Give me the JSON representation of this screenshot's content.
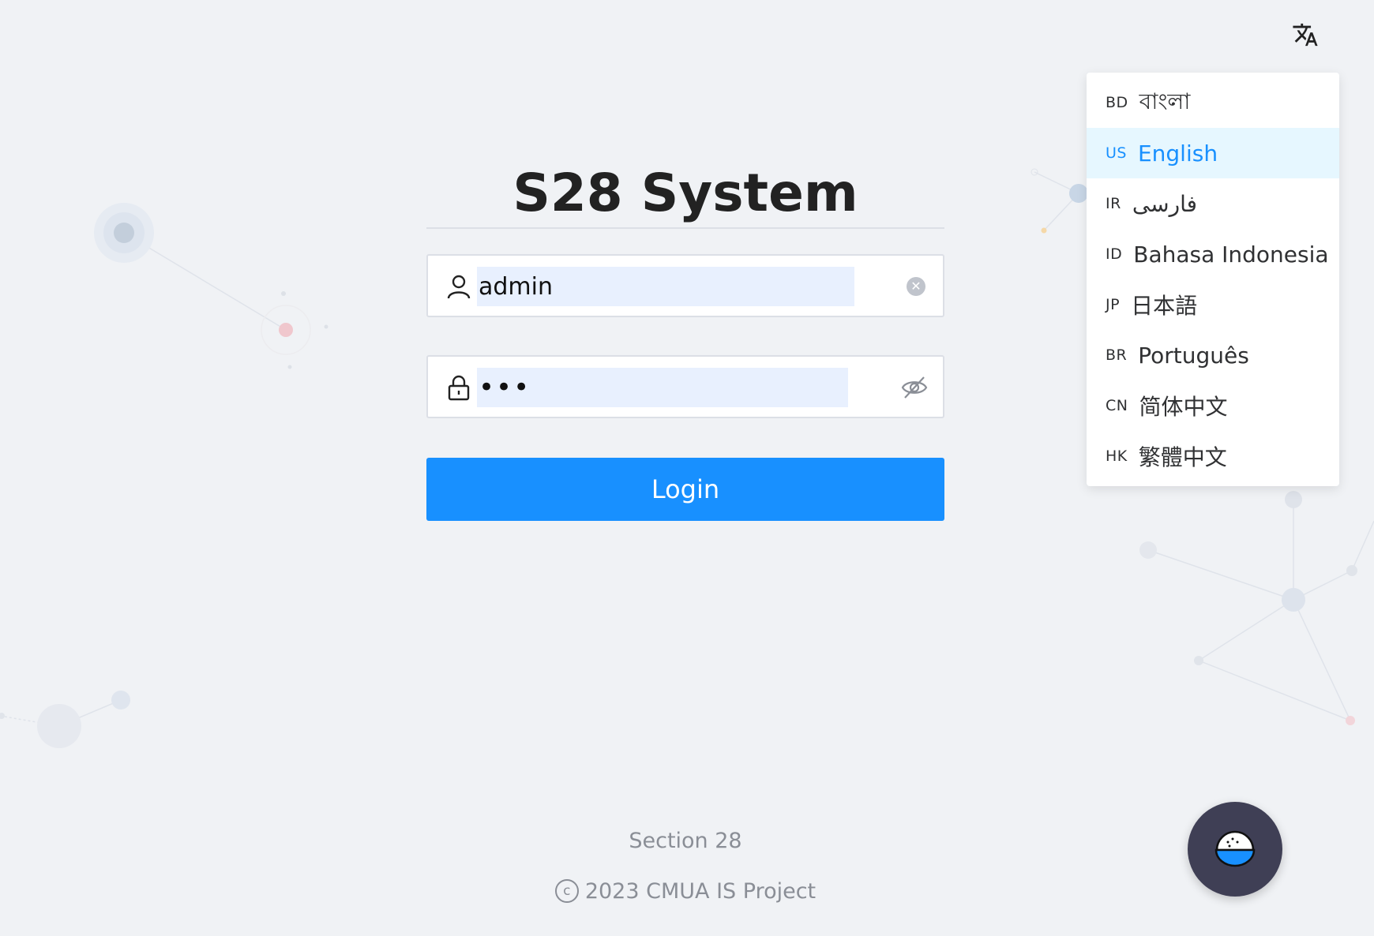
{
  "app": {
    "title": "S28 System"
  },
  "login": {
    "username_value": "admin",
    "password_value": "•••",
    "login_label": "Login"
  },
  "language_menu": {
    "toggle_icon": "translate-icon",
    "selected": "English",
    "items": [
      {
        "code": "BD",
        "label": "বাংলা"
      },
      {
        "code": "US",
        "label": "English"
      },
      {
        "code": "IR",
        "label": "فارسی"
      },
      {
        "code": "ID",
        "label": "Bahasa Indonesia"
      },
      {
        "code": "JP",
        "label": "日本語"
      },
      {
        "code": "BR",
        "label": "Português"
      },
      {
        "code": "CN",
        "label": "简体中文"
      },
      {
        "code": "HK",
        "label": "繁體中文"
      }
    ]
  },
  "footer": {
    "section": "Section 28",
    "copyright_symbol": "c",
    "copyright": "2023 CMUA IS Project"
  },
  "floating_button": {
    "icon": "rice-bowl-icon"
  },
  "colors": {
    "primary": "#1890ff",
    "background": "#f0f2f5",
    "active_item_bg": "#e6f7ff",
    "float_button": "#3f3f55"
  }
}
